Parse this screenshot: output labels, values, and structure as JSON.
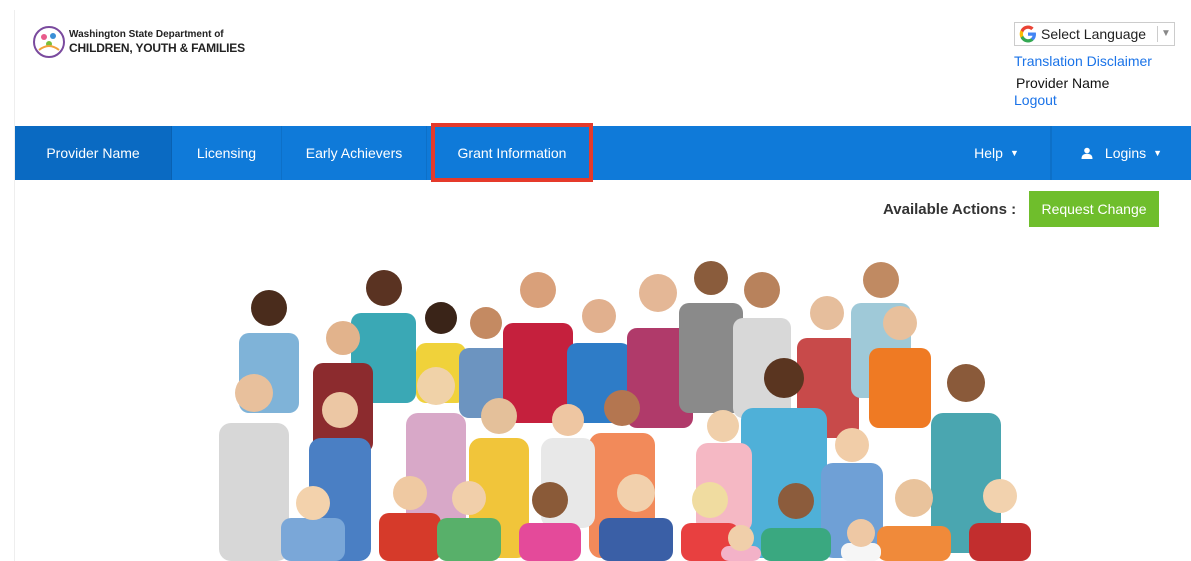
{
  "header": {
    "logo_line1": "Washington State Department of",
    "logo_line2": "CHILDREN, YOUTH & FAMILIES",
    "language_label": "Select Language",
    "translation_disclaimer": "Translation Disclaimer",
    "provider_name": "Provider Name",
    "logout": "Logout"
  },
  "nav": {
    "items": [
      {
        "label": "Provider Name",
        "active": true
      },
      {
        "label": "Licensing"
      },
      {
        "label": "Early Achievers"
      },
      {
        "label": "Grant Information",
        "highlighted": true
      }
    ],
    "help": "Help",
    "logins": "Logins"
  },
  "actions": {
    "label": "Available Actions :",
    "request_change": "Request Change"
  },
  "colors": {
    "nav_bg": "#0f7ad9",
    "highlight_border": "#e53a2b",
    "button_green": "#6fbe2c",
    "link_blue": "#1a73e8"
  },
  "hero": {
    "icon": "children-group-photo"
  }
}
